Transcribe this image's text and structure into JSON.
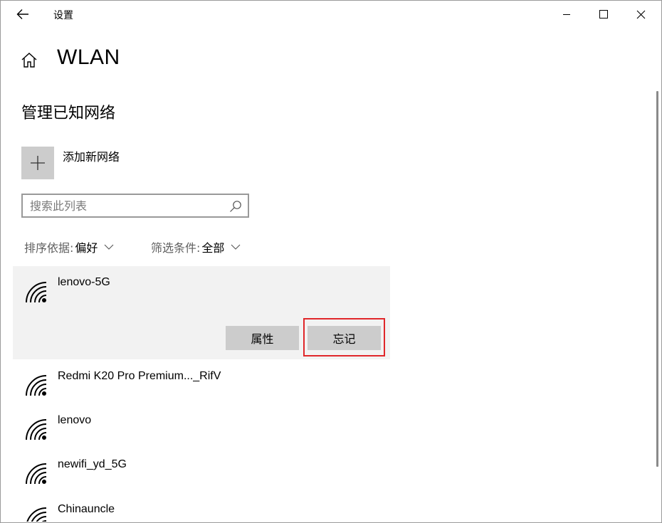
{
  "window": {
    "title": "设置",
    "icons": {
      "back": "back-arrow-icon",
      "minimize": "minimize-icon",
      "maximize": "maximize-icon",
      "close": "close-icon"
    }
  },
  "header": {
    "title": "WLAN",
    "home_icon": "home-icon"
  },
  "section": {
    "title": "管理已知网络"
  },
  "add_network": {
    "label": "添加新网络",
    "icon": "plus-icon"
  },
  "search": {
    "placeholder": "搜索此列表",
    "value": "",
    "icon": "search-icon"
  },
  "filters": {
    "sort_label": "排序依据:",
    "sort_value": "偏好",
    "filter_label": "筛选条件:",
    "filter_value": "全部"
  },
  "networks": [
    {
      "name": "lenovo-5G",
      "expanded": true
    },
    {
      "name": "Redmi K20 Pro Premium..._RifV"
    },
    {
      "name": "lenovo"
    },
    {
      "name": "newifi_yd_5G"
    },
    {
      "name": "Chinauncle"
    }
  ],
  "actions": {
    "properties": "属性",
    "forget": "忘记"
  },
  "colors": {
    "highlight": "#e0272a",
    "button": "#cccccc",
    "selected_row": "#f2f2f2"
  }
}
